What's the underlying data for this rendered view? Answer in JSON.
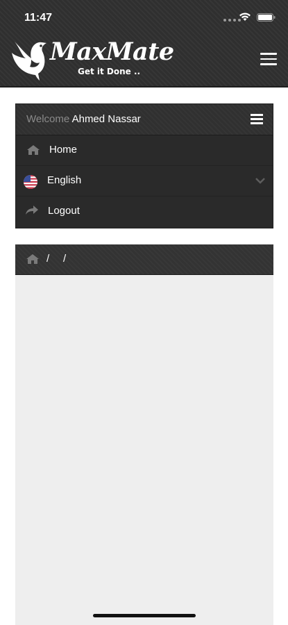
{
  "status_bar": {
    "time": "11:47",
    "icons": [
      "cellular-dots-icon",
      "wifi-icon",
      "battery-icon"
    ]
  },
  "header": {
    "brand": "MaxMate",
    "tagline": "Get it Done ..",
    "logo_icon": "bird-logo-icon",
    "menu_icon": "hamburger-icon"
  },
  "menu": {
    "welcome_label": "Welcome",
    "user_name": "Ahmed Nassar",
    "items": [
      {
        "label": "Home",
        "icon": "home-icon"
      },
      {
        "label": "English",
        "icon": "us-flag-icon",
        "trailing_icon": "chevron-down-icon"
      },
      {
        "label": "Logout",
        "icon": "share-arrow-icon"
      }
    ]
  },
  "breadcrumb": {
    "home_icon": "home-icon",
    "separators": [
      "/",
      "/"
    ]
  },
  "colors": {
    "header_bg": "#2f2f2f",
    "panel_bg": "#2a2a2a",
    "content_bg": "#eeeeee",
    "muted_text": "#8a8a8a",
    "text": "#ffffff"
  }
}
